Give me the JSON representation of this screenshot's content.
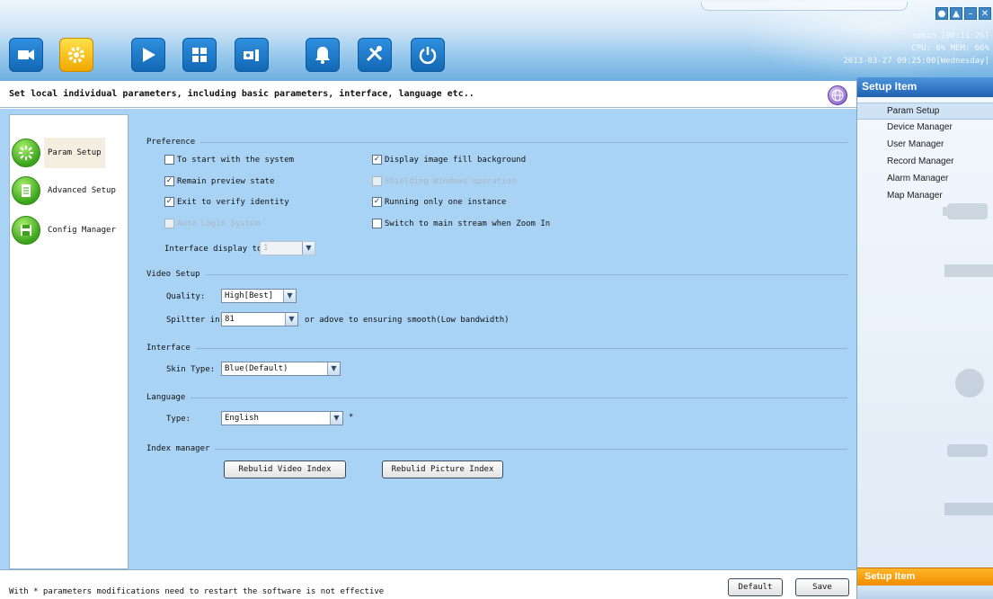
{
  "toolbar": {
    "buttons": [
      {
        "name": "camera-icon"
      },
      {
        "name": "settings-icon"
      },
      {
        "name": "play-icon"
      },
      {
        "name": "grid-icon"
      },
      {
        "name": "record-icon"
      },
      {
        "name": "alarm-bell-icon"
      },
      {
        "name": "tools-icon"
      },
      {
        "name": "power-icon"
      }
    ]
  },
  "sysinfo": {
    "user": "admin",
    "session": "[00:11:26]",
    "cpu": "CPU:  6%",
    "mem": "MEM: 66%",
    "datetime": "2013-03-27 09:25:00[Wednesday]"
  },
  "description": "Set local individual parameters, including basic parameters, interface, language etc..",
  "nav": {
    "items": [
      {
        "label": "Param Setup"
      },
      {
        "label": "Advanced Setup"
      },
      {
        "label": "Config Manager"
      }
    ]
  },
  "preference": {
    "title": "Preference",
    "to_start": "To start with the system",
    "remain_preview": "Remain preview state",
    "exit_verify": "Exit to verify identity",
    "auto_login": "Auto Login System",
    "display_fill": "Display image fill background",
    "shielding": "Shielding Windows operation",
    "running_one": "Running only one instance",
    "switch_main": "Switch to main stream when Zoom In",
    "interface_display_label": "Interface display to",
    "interface_display_value": "1"
  },
  "video": {
    "title": "Video Setup",
    "quality_label": "Quality:",
    "quality_value": "High[Best]",
    "splitter_label": "Spiltter in",
    "splitter_value": "81",
    "splitter_suffix": "or adove to ensuring smooth(Low bandwidth)"
  },
  "interface": {
    "title": "Interface",
    "skin_label": "Skin Type:",
    "skin_value": "Blue(Default)"
  },
  "language": {
    "title": "Language",
    "type_label": "Type:",
    "type_value": "English",
    "asterisk": "*"
  },
  "index": {
    "title": "Index manager",
    "rebuild_video": "Rebulid Video Index",
    "rebuild_picture": "Rebulid Picture Index"
  },
  "footer": {
    "note": "With * parameters modifications need to restart the software is not effective",
    "default": "Default",
    "save": "Save"
  },
  "right": {
    "title": "Setup Item",
    "items": [
      {
        "label": "Param Setup"
      },
      {
        "label": "Device Manager"
      },
      {
        "label": "User Manager"
      },
      {
        "label": "Record Manager"
      },
      {
        "label": "Alarm Manager"
      },
      {
        "label": "Map Manager"
      }
    ],
    "footer": "Setup Item"
  }
}
